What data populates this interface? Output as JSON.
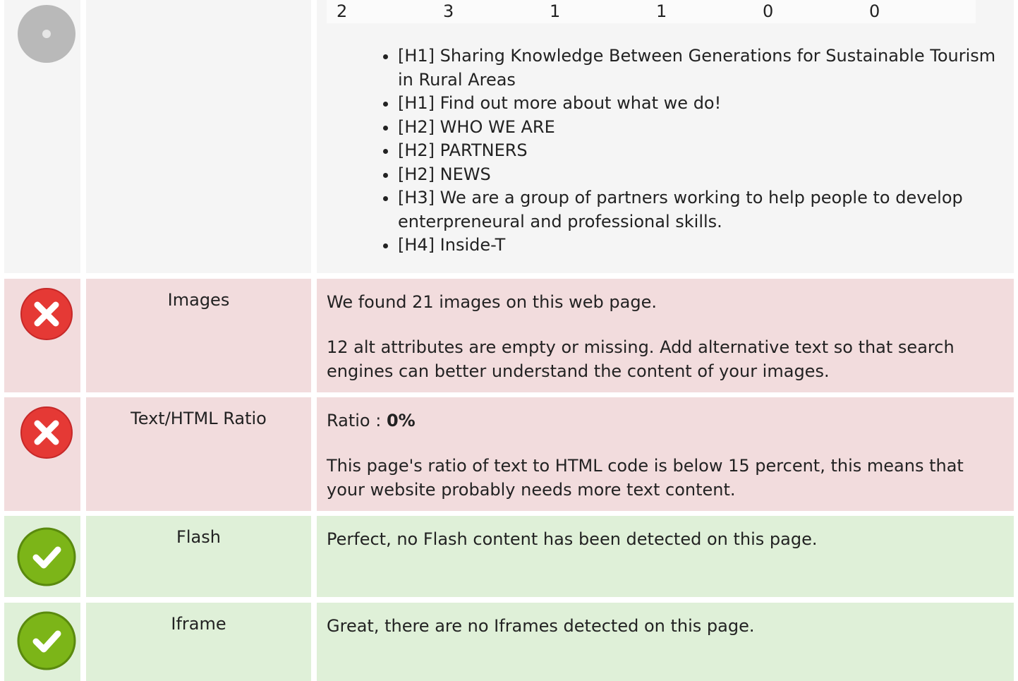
{
  "headings_section": {
    "counts": [
      "2",
      "3",
      "1",
      "1",
      "0",
      "0"
    ],
    "items": [
      "[H1] Sharing Knowledge Between Generations for Sustainable Tourism in Rural Areas",
      "[H1] Find out more about what we do!",
      "[H2] WHO WE ARE",
      "[H2] PARTNERS",
      "[H2] NEWS",
      "[H3] We are a group of partners working to help people to develop enterpreneural and professional skills.",
      "[H4] Inside-T"
    ]
  },
  "images_row": {
    "label": "Images",
    "line1": "We found 21 images on this web page.",
    "line2": "12 alt attributes are empty or missing. Add alternative text so that search engines can better understand the content of your images."
  },
  "ratio_row": {
    "label": "Text/HTML Ratio",
    "ratio_prefix": "Ratio : ",
    "ratio_value": "0%",
    "line2": "This page's ratio of text to HTML code is below 15 percent, this means that your website probably needs more text content."
  },
  "flash_row": {
    "label": "Flash",
    "line1": "Perfect, no Flash content has been detected on this page."
  },
  "iframe_row": {
    "label": "Iframe",
    "line1": "Great, there are no Iframes detected on this page."
  },
  "icons": {
    "neutral": "info-circle-icon",
    "fail": "error-x-icon",
    "pass": "check-circle-icon"
  },
  "colors": {
    "fail_bg": "#f2dcdd",
    "pass_bg": "#dff0d8",
    "neutral_bg": "#f5f5f5",
    "fail_icon": "#e53935",
    "pass_icon": "#7cb518"
  }
}
